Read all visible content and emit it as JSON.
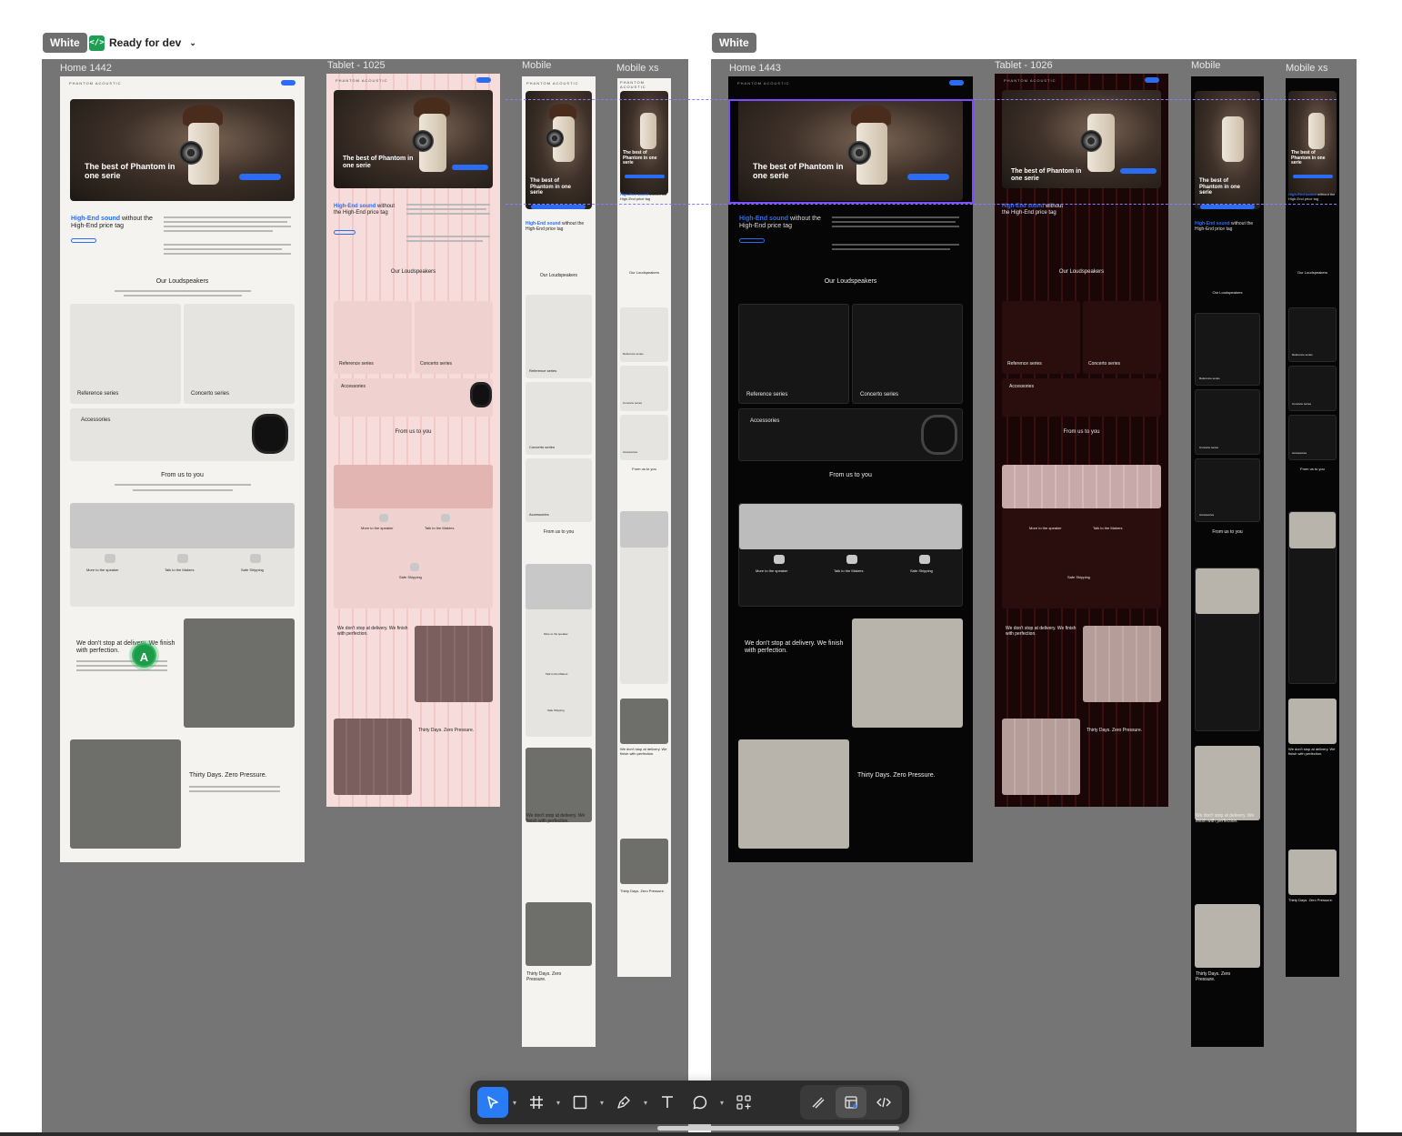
{
  "sections": [
    {
      "tag": "White",
      "status": "Ready for dev"
    },
    {
      "tag": "White"
    }
  ],
  "frames": [
    "Home 1442",
    "Tablet - 1025",
    "Mobile",
    "Mobile xs",
    "Home 1443",
    "Tablet - 1026",
    "Mobile",
    "Mobile xs"
  ],
  "mock": {
    "brand": "PHANTOM ACOUSTIC",
    "hero_title": "The best of Phantom in one serie",
    "headline_accent": "High-End sound",
    "headline_rest": "without the High-End price tag",
    "loudspeakers": "Our Loudspeakers",
    "reference": "Reference series",
    "concerto": "Concerto series",
    "accessories": "Accessories",
    "from_us": "From us to you",
    "more_speaker": "More to the speaker",
    "talk_makers": "Talk to the Makers",
    "safe_shipping": "Safe Shipping",
    "delivery": "We don't stop at delivery. We finish with perfection.",
    "thirty_days": "Thirty Days. Zero Pressure."
  },
  "avatar": "A",
  "toolbar": [
    {
      "icon": "move-icon",
      "active": true
    },
    {
      "icon": "frame-icon"
    },
    {
      "icon": "rectangle-icon"
    },
    {
      "icon": "pen-icon"
    },
    {
      "icon": "text-icon"
    },
    {
      "icon": "comment-icon"
    },
    {
      "icon": "actions-icon"
    },
    {
      "icon": "draw-mode-icon"
    },
    {
      "icon": "design-mode-icon",
      "selected": true
    },
    {
      "icon": "dev-mode-icon"
    }
  ],
  "colors": {
    "accent": "#2a6df4",
    "dev_tag": "#1f9d55",
    "avatar": "#1e9b4a",
    "selection": "#7c4dff"
  }
}
